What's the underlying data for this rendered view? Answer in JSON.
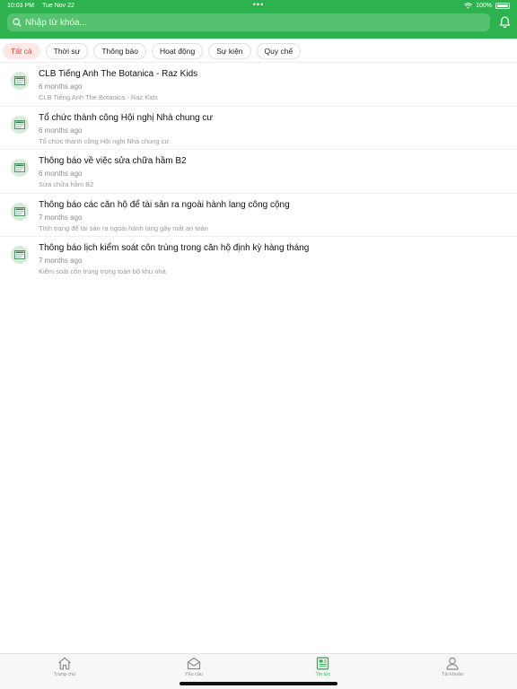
{
  "status_bar": {
    "time": "10:03 PM",
    "date": "Tue Nov 22",
    "dots": "•••",
    "battery": "100%"
  },
  "search": {
    "placeholder": "Nhập từ khóa..."
  },
  "filters": [
    "Tất cả",
    "Thời sự",
    "Thông báo",
    "Hoạt động",
    "Sự kiện",
    "Quy chế"
  ],
  "news": [
    {
      "title": "CLB Tiếng Anh The Botanica - Raz Kids",
      "time": "6 months ago",
      "summary": "CLB Tiếng Anh The Botanica - Raz Kids"
    },
    {
      "title": "Tổ chức thành công Hội nghị Nhà chung cư",
      "time": "6 months ago",
      "summary": "Tổ chức thành công Hội nghị Nhà chung cư"
    },
    {
      "title": "Thông báo về việc sửa chữa hầm B2",
      "time": "6 months ago",
      "summary": "Sửa chữa hầm B2"
    },
    {
      "title": "Thông báo các căn hộ để tài sản ra ngoài hành lang công cộng",
      "time": "7 months ago",
      "summary": "Tình trạng để tài sản ra ngoài hành lang gây mất an toàn"
    },
    {
      "title": "Thông báo lịch kiểm soát côn trùng trong căn hộ định kỳ hàng tháng",
      "time": "7 months ago",
      "summary": "Kiểm soát côn trùng trọng toàn bộ khu nhà"
    }
  ],
  "tabs": [
    {
      "label": "Trang chủ",
      "icon": "home-icon"
    },
    {
      "label": "Yêu cầu",
      "icon": "mail-icon"
    },
    {
      "label": "Tin tức",
      "icon": "newspaper-icon"
    },
    {
      "label": "Tài khoản",
      "icon": "user-icon"
    }
  ],
  "colors": {
    "brand": "#2eb24f",
    "chip_active_bg": "#fde8e6",
    "chip_active_text": "#e0463b"
  }
}
